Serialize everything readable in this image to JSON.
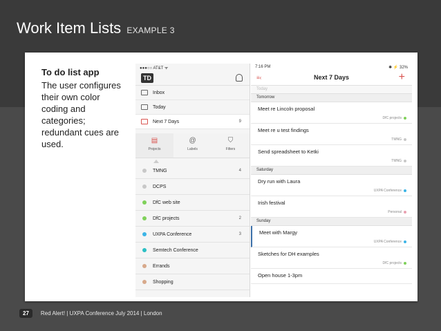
{
  "slide": {
    "title": "Work Item Lists",
    "subtitle": "EXAMPLE 3",
    "note_heading": "To do list app",
    "note_body": "The user configures their own color coding and categories; redundant cues are used.",
    "page_number": "27",
    "footer_text": "Red Alert! | UXPA Conference July 2014 | London"
  },
  "sidebar": {
    "status": "●●●○○ AT&T ᯤ",
    "logo": "TD",
    "nav": [
      {
        "label": "Inbox",
        "count": ""
      },
      {
        "label": "Today",
        "count": ""
      },
      {
        "label": "Next 7 Days",
        "count": "9"
      }
    ],
    "tabs": [
      {
        "label": "Projects",
        "icon": "▤"
      },
      {
        "label": "Labels",
        "icon": "@"
      },
      {
        "label": "Filters",
        "icon": "⛉"
      }
    ],
    "projects": [
      {
        "label": "TMNG",
        "count": "4",
        "color": "#c8c8c8"
      },
      {
        "label": "DCPS",
        "count": "",
        "color": "#c8c8c8"
      },
      {
        "label": "DfC web site",
        "count": "",
        "color": "#7fd15a"
      },
      {
        "label": "DfC projects",
        "count": "2",
        "color": "#7fd15a"
      },
      {
        "label": "UXPA Conference",
        "count": "3",
        "color": "#3cb4e6"
      },
      {
        "label": "Semtech Conference",
        "count": "",
        "color": "#2bbfc4"
      },
      {
        "label": "Errands",
        "count": "",
        "color": "#d7a98b"
      },
      {
        "label": "Shopping",
        "count": "",
        "color": "#d7a98b"
      }
    ]
  },
  "main": {
    "status_time": "7:16 PM",
    "status_right": "✱ ⚡ 32%",
    "title": "Next 7 Days",
    "menu_icon": "≡‹",
    "add_icon": "+",
    "sections": [
      {
        "label": "Today",
        "faint": true,
        "tasks": []
      },
      {
        "label": "Tomorrow",
        "faint": false,
        "tasks": [
          {
            "text": "Meet re Lincoln proposal",
            "tag": "DfC projects",
            "color": "#7fd15a"
          },
          {
            "text": "Meet re u test findings",
            "tag": "TMNG",
            "color": "#c8c8c8"
          },
          {
            "text": "Send spreadsheet to Ketki",
            "tag": "TMNG",
            "color": "#c8c8c8"
          }
        ]
      },
      {
        "label": "Saturday",
        "faint": false,
        "tasks": [
          {
            "text": "Dry run with Laura",
            "tag": "UXPA Conference",
            "color": "#3cb4e6"
          },
          {
            "text": "Irish festival",
            "tag": "Personal",
            "color": "#e8a0b0"
          }
        ]
      },
      {
        "label": "Sunday",
        "faint": false,
        "tasks": [
          {
            "text": "Meet with Margy",
            "tag": "UXPA Conference",
            "color": "#3cb4e6"
          },
          {
            "text": "Sketches for DH examples",
            "tag": "DfC projects",
            "color": "#7fd15a"
          },
          {
            "text": "Open house 1-3pm",
            "tag": "",
            "color": ""
          }
        ]
      }
    ]
  }
}
